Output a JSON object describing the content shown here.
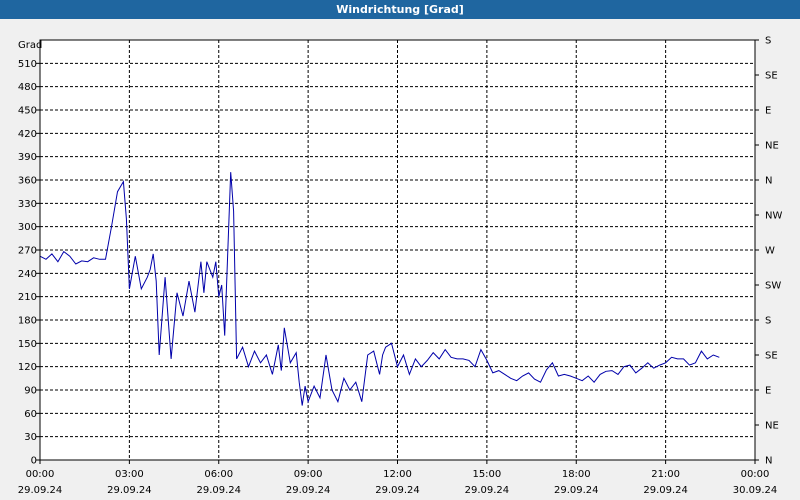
{
  "window": {
    "title": "Windrichtung [Grad]"
  },
  "chart_data": {
    "type": "line",
    "ylabel": "Grad",
    "ylim": [
      0,
      540
    ],
    "yticks": [
      0,
      30,
      60,
      90,
      120,
      150,
      180,
      210,
      240,
      270,
      300,
      330,
      360,
      390,
      420,
      450,
      480,
      510
    ],
    "right_axis_labels": [
      "N",
      "NE",
      "E",
      "SE",
      "S",
      "SW",
      "W",
      "NW",
      "N",
      "NE",
      "E",
      "SE",
      "S"
    ],
    "x_ticks": [
      {
        "time": "00:00",
        "date": "29.09.24"
      },
      {
        "time": "03:00",
        "date": "29.09.24"
      },
      {
        "time": "06:00",
        "date": "29.09.24"
      },
      {
        "time": "09:00",
        "date": "29.09.24"
      },
      {
        "time": "12:00",
        "date": "29.09.24"
      },
      {
        "time": "15:00",
        "date": "29.09.24"
      },
      {
        "time": "18:00",
        "date": "29.09.24"
      },
      {
        "time": "21:00",
        "date": "29.09.24"
      },
      {
        "time": "00:00",
        "date": "30.09.24"
      }
    ],
    "grid": true,
    "line_color": "#0000aa",
    "series": [
      {
        "x_hours": [
          0,
          0.2,
          0.4,
          0.6,
          0.8,
          1.0,
          1.2,
          1.4,
          1.6,
          1.8,
          2.0,
          2.2,
          2.4,
          2.6,
          2.8,
          2.9,
          3.0,
          3.2,
          3.4,
          3.6,
          3.7,
          3.8,
          3.9,
          4.0,
          4.2,
          4.4,
          4.6,
          4.8,
          5.0,
          5.2,
          5.4,
          5.5,
          5.6,
          5.8,
          5.9,
          6.0,
          6.1,
          6.2,
          6.4,
          6.5,
          6.6,
          6.8,
          7.0,
          7.2,
          7.4,
          7.6,
          7.8,
          8.0,
          8.1,
          8.2,
          8.4,
          8.6,
          8.7,
          8.8,
          8.9,
          9.0,
          9.2,
          9.4,
          9.6,
          9.8,
          10.0,
          10.2,
          10.4,
          10.6,
          10.8,
          11.0,
          11.2,
          11.4,
          11.5,
          11.6,
          11.8,
          12.0,
          12.2,
          12.4,
          12.6,
          12.8,
          13.0,
          13.2,
          13.4,
          13.6,
          13.8,
          14.0,
          14.2,
          14.4,
          14.6,
          14.8,
          15.0,
          15.2,
          15.4,
          15.6,
          15.8,
          16.0,
          16.2,
          16.4,
          16.6,
          16.8,
          17.0,
          17.2,
          17.4,
          17.6,
          17.8,
          18.0,
          18.2,
          18.4,
          18.6,
          18.8,
          19.0,
          19.2,
          19.4,
          19.6,
          19.8,
          20.0,
          20.2,
          20.4,
          20.6,
          20.8,
          21.0,
          21.2,
          21.4,
          21.6,
          21.8,
          22.0,
          22.2,
          22.4,
          22.6,
          22.8,
          23.0,
          23.2,
          23.4,
          23.6,
          23.8,
          24.0
        ],
        "values": [
          262,
          258,
          265,
          255,
          268,
          262,
          252,
          256,
          255,
          260,
          258,
          258,
          300,
          345,
          358,
          310,
          220,
          262,
          220,
          235,
          245,
          265,
          230,
          135,
          235,
          130,
          215,
          185,
          230,
          190,
          255,
          215,
          255,
          235,
          255,
          210,
          225,
          160,
          370,
          320,
          130,
          145,
          120,
          140,
          125,
          135,
          110,
          148,
          115,
          170,
          125,
          138,
          100,
          70,
          95,
          75,
          95,
          80,
          135,
          90,
          75,
          105,
          90,
          100,
          75,
          135,
          140,
          110,
          135,
          145,
          150,
          120,
          135,
          110,
          130,
          120,
          128,
          138,
          130,
          142,
          132,
          130,
          130,
          128,
          120,
          142,
          128,
          112,
          115,
          110,
          105,
          102,
          108,
          112,
          104,
          100,
          116,
          125,
          108,
          110,
          108,
          105,
          102,
          108,
          100,
          110,
          114,
          115,
          110,
          120,
          122,
          112,
          118,
          125,
          118,
          122,
          125,
          132,
          130,
          130,
          122,
          125,
          140,
          130,
          135,
          132
        ]
      }
    ]
  }
}
